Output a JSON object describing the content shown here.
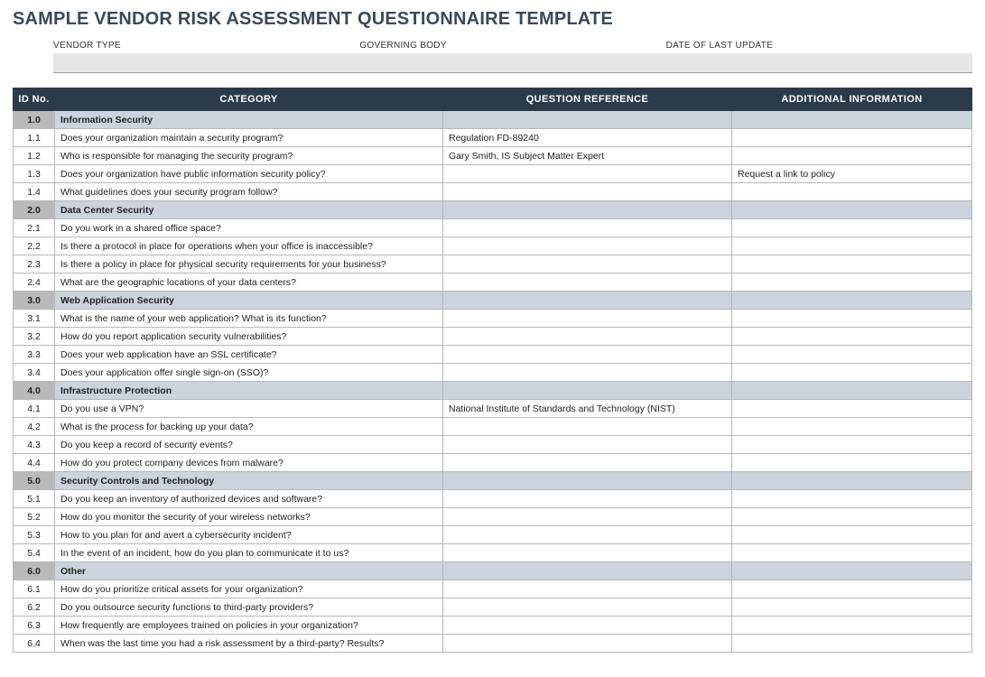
{
  "title": "SAMPLE VENDOR RISK ASSESSMENT QUESTIONNAIRE TEMPLATE",
  "meta": {
    "vendor_type_label": "VENDOR TYPE",
    "vendor_type_value": "",
    "governing_body_label": "GOVERNING BODY",
    "governing_body_value": "",
    "date_label": "DATE OF LAST UPDATE",
    "date_value": ""
  },
  "headers": {
    "id": "ID No.",
    "category": "CATEGORY",
    "reference": "QUESTION REFERENCE",
    "additional": "ADDITIONAL INFORMATION"
  },
  "sections": [
    {
      "id": "1.0",
      "name": "Information Security",
      "rows": [
        {
          "id": "1.1",
          "q": "Does your organization maintain a security program?",
          "ref": "Regulation FD-89240",
          "add": ""
        },
        {
          "id": "1.2",
          "q": "Who is responsible for managing the security program?",
          "ref": "Gary Smith, IS Subject Matter Expert",
          "add": ""
        },
        {
          "id": "1.3",
          "q": "Does your organization have public information security policy?",
          "ref": "",
          "add": "Request a link to policy"
        },
        {
          "id": "1.4",
          "q": "What guidelines does your security program follow?",
          "ref": "",
          "add": ""
        }
      ]
    },
    {
      "id": "2.0",
      "name": "Data Center Security",
      "rows": [
        {
          "id": "2.1",
          "q": "Do you work in a shared office space?",
          "ref": "",
          "add": ""
        },
        {
          "id": "2.2",
          "q": "Is there a protocol in place for operations when your office is inaccessible?",
          "ref": "",
          "add": ""
        },
        {
          "id": "2.3",
          "q": "Is there a policy in place for physical security requirements for your business?",
          "ref": "",
          "add": ""
        },
        {
          "id": "2.4",
          "q": "What are the geographic locations of your data centers?",
          "ref": "",
          "add": ""
        }
      ]
    },
    {
      "id": "3.0",
      "name": "Web Application Security",
      "rows": [
        {
          "id": "3.1",
          "q": "What is the name of your web application? What is its function?",
          "ref": "",
          "add": ""
        },
        {
          "id": "3.2",
          "q": "How do you report application security vulnerabilities?",
          "ref": "",
          "add": ""
        },
        {
          "id": "3.3",
          "q": "Does your web application have an SSL certificate?",
          "ref": "",
          "add": ""
        },
        {
          "id": "3.4",
          "q": "Does your application offer single sign-on (SSO)?",
          "ref": "",
          "add": ""
        }
      ]
    },
    {
      "id": "4.0",
      "name": "Infrastructure Protection",
      "rows": [
        {
          "id": "4.1",
          "q": "Do you use a VPN?",
          "ref": "National Institute of Standards and Technology (NIST)",
          "add": ""
        },
        {
          "id": "4.2",
          "q": "What is the process for backing up your data?",
          "ref": "",
          "add": ""
        },
        {
          "id": "4.3",
          "q": "Do you keep a record of security events?",
          "ref": "",
          "add": ""
        },
        {
          "id": "4.4",
          "q": "How do you protect company devices from malware?",
          "ref": "",
          "add": ""
        }
      ]
    },
    {
      "id": "5.0",
      "name": "Security Controls and Technology",
      "rows": [
        {
          "id": "5.1",
          "q": "Do you keep an inventory of authorized devices and software?",
          "ref": "",
          "add": ""
        },
        {
          "id": "5.2",
          "q": "How do you monitor the security of your wireless networks?",
          "ref": "",
          "add": ""
        },
        {
          "id": "5.3",
          "q": "How to you plan for and avert a cybersecurity incident?",
          "ref": "",
          "add": ""
        },
        {
          "id": "5.4",
          "q": "In the event of an incident, how do you plan to communicate it to us?",
          "ref": "",
          "add": ""
        }
      ]
    },
    {
      "id": "6.0",
      "name": "Other",
      "rows": [
        {
          "id": "6.1",
          "q": "How do you prioritize critical assets for your organization?",
          "ref": "",
          "add": ""
        },
        {
          "id": "6.2",
          "q": "Do you outsource security functions to third-party providers?",
          "ref": "",
          "add": ""
        },
        {
          "id": "6.3",
          "q": "How frequently are employees trained on policies in your organization?",
          "ref": "",
          "add": ""
        },
        {
          "id": "6.4",
          "q": "When was the last time you had a risk assessment by a third-party? Results?",
          "ref": "",
          "add": ""
        }
      ]
    }
  ]
}
